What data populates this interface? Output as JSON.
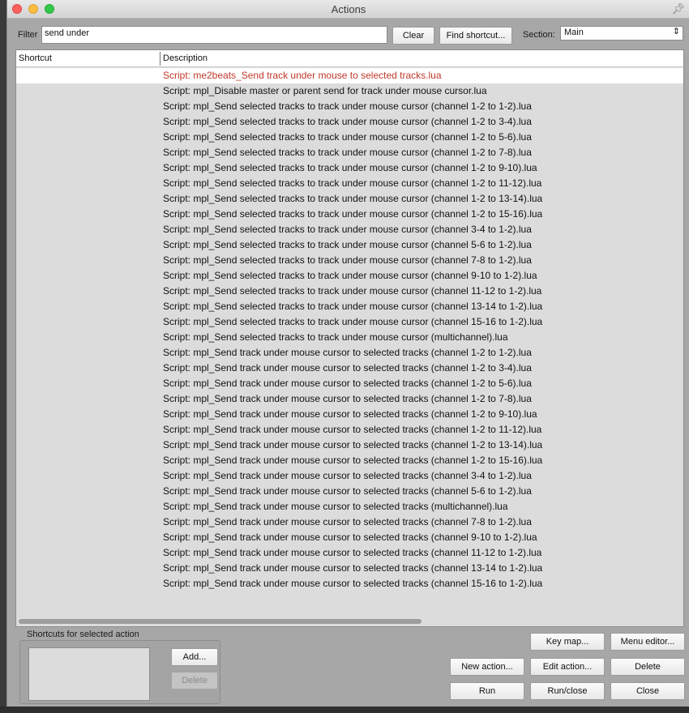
{
  "window": {
    "title": "Actions"
  },
  "filter": {
    "label": "Filter",
    "value": "send under"
  },
  "buttons": {
    "clear": "Clear",
    "find_shortcut": "Find shortcut...",
    "add": "Add...",
    "delete_shortcut": "Delete",
    "key_map": "Key map...",
    "menu_editor": "Menu editor...",
    "new_action": "New action...",
    "edit_action": "Edit action...",
    "delete_action": "Delete",
    "run": "Run",
    "run_close": "Run/close",
    "close": "Close"
  },
  "section": {
    "label": "Section:",
    "value": "Main"
  },
  "table": {
    "headers": [
      "Shortcut",
      "Description"
    ],
    "rows": [
      "Script: me2beats_Send track under mouse to selected tracks.lua",
      "Script: mpl_Disable master or parent send for track under mouse cursor.lua",
      "Script: mpl_Send selected tracks to track under mouse cursor (channel 1-2 to 1-2).lua",
      "Script: mpl_Send selected tracks to track under mouse cursor (channel 1-2 to 3-4).lua",
      "Script: mpl_Send selected tracks to track under mouse cursor (channel 1-2 to 5-6).lua",
      "Script: mpl_Send selected tracks to track under mouse cursor (channel 1-2 to 7-8).lua",
      "Script: mpl_Send selected tracks to track under mouse cursor (channel 1-2 to 9-10).lua",
      "Script: mpl_Send selected tracks to track under mouse cursor (channel 1-2 to 11-12).lua",
      "Script: mpl_Send selected tracks to track under mouse cursor (channel 1-2 to 13-14).lua",
      "Script: mpl_Send selected tracks to track under mouse cursor (channel 1-2 to 15-16).lua",
      "Script: mpl_Send selected tracks to track under mouse cursor (channel 3-4 to 1-2).lua",
      "Script: mpl_Send selected tracks to track under mouse cursor (channel 5-6 to 1-2).lua",
      "Script: mpl_Send selected tracks to track under mouse cursor (channel 7-8 to 1-2).lua",
      "Script: mpl_Send selected tracks to track under mouse cursor (channel 9-10 to 1-2).lua",
      "Script: mpl_Send selected tracks to track under mouse cursor (channel 11-12 to 1-2).lua",
      "Script: mpl_Send selected tracks to track under mouse cursor (channel 13-14 to 1-2).lua",
      "Script: mpl_Send selected tracks to track under mouse cursor (channel 15-16 to 1-2).lua",
      "Script: mpl_Send selected tracks to track under mouse cursor (multichannel).lua",
      "Script: mpl_Send track under mouse cursor to selected tracks  (channel 1-2 to 1-2).lua",
      "Script: mpl_Send track under mouse cursor to selected tracks  (channel 1-2 to 3-4).lua",
      "Script: mpl_Send track under mouse cursor to selected tracks  (channel 1-2 to 5-6).lua",
      "Script: mpl_Send track under mouse cursor to selected tracks  (channel 1-2 to 7-8).lua",
      "Script: mpl_Send track under mouse cursor to selected tracks  (channel 1-2 to 9-10).lua",
      "Script: mpl_Send track under mouse cursor to selected tracks  (channel 1-2 to 11-12).lua",
      "Script: mpl_Send track under mouse cursor to selected tracks  (channel 1-2 to 13-14).lua",
      "Script: mpl_Send track under mouse cursor to selected tracks  (channel 1-2 to 15-16).lua",
      "Script: mpl_Send track under mouse cursor to selected tracks  (channel 3-4 to 1-2).lua",
      "Script: mpl_Send track under mouse cursor to selected tracks  (channel 5-6 to 1-2).lua",
      "Script: mpl_Send track under mouse cursor to selected tracks  (multichannel).lua",
      "Script: mpl_Send track under mouse cursor to selected tracks (channel 7-8 to 1-2).lua",
      "Script: mpl_Send track under mouse cursor to selected tracks (channel 9-10 to 1-2).lua",
      "Script: mpl_Send track under mouse cursor to selected tracks (channel 11-12 to 1-2).lua",
      "Script: mpl_Send track under mouse cursor to selected tracks (channel 13-14 to 1-2).lua",
      "Script: mpl_Send track under mouse cursor to selected tracks (channel 15-16 to 1-2).lua"
    ],
    "selected_index": 0
  },
  "shortcuts_panel": {
    "label": "Shortcuts for selected action"
  },
  "icons": {
    "pin": "pin-icon",
    "section_arrows": "updown-arrows-icon"
  }
}
